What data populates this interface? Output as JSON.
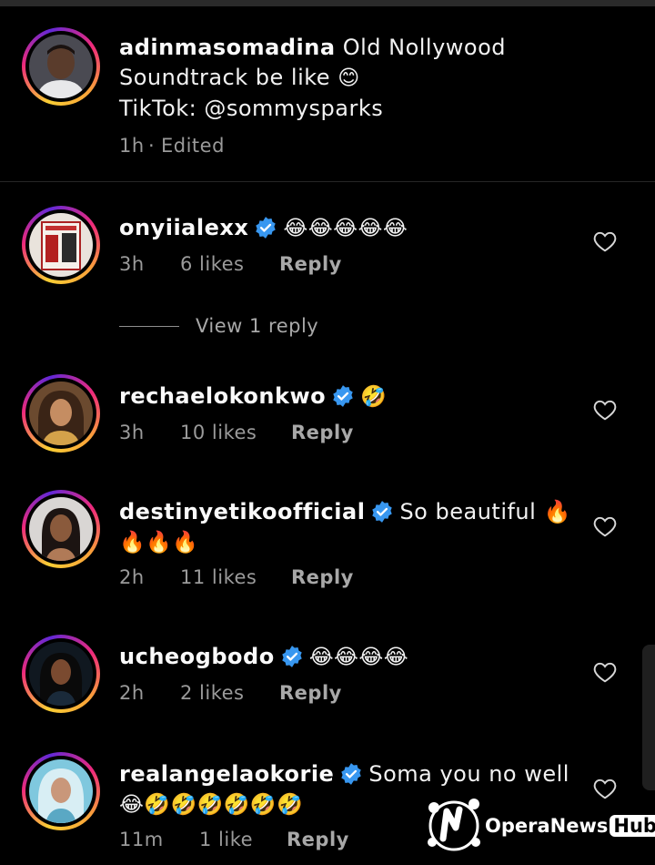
{
  "post_caption": {
    "username": "adinmasomadina",
    "text_line1": "Old Nollywood",
    "text_line2": "Soundtrack be like",
    "emoji": "😊",
    "text_line3": "TikTok: @sommysparks",
    "time": "1h",
    "separator": "·",
    "edited": "Edited"
  },
  "comments": [
    {
      "username": "onyiialexx",
      "verified": true,
      "text": "😂😂😂😂😂",
      "time": "3h",
      "likes": "6 likes",
      "reply": "Reply"
    },
    {
      "username": "rechaelokonkwo",
      "verified": true,
      "text": "🤣",
      "time": "3h",
      "likes": "10 likes",
      "reply": "Reply"
    },
    {
      "username": "destinyetikoofficial",
      "verified": true,
      "text": "So beautiful 🔥",
      "text2": "🔥🔥🔥",
      "time": "2h",
      "likes": "11 likes",
      "reply": "Reply"
    },
    {
      "username": "ucheogbodo",
      "verified": true,
      "text": "😂😂😂😂",
      "time": "2h",
      "likes": "2 likes",
      "reply": "Reply"
    },
    {
      "username": "realangelaokorie",
      "verified": true,
      "text": "Soma you no well",
      "text2": "😂🤣🤣🤣🤣🤣🤣",
      "time": "11m",
      "likes": "1 like",
      "reply": "Reply"
    }
  ],
  "view_replies": "View 1 reply",
  "watermark": {
    "brand": "OperaNews",
    "hub": "Hub"
  },
  "colors": {
    "background": "#000000",
    "verified": "#3897f0",
    "meta_text": "#9a9a9a"
  },
  "icons": [
    "heart-outline-icon",
    "verified-badge-icon"
  ]
}
